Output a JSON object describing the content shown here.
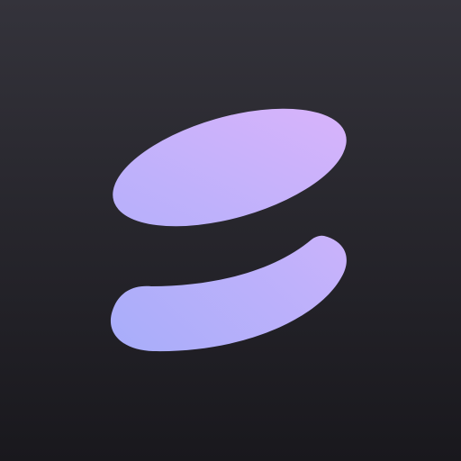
{
  "app_icon": {
    "name": "logo-mark",
    "shapes": [
      "upper-ellipse",
      "lower-crescent"
    ],
    "colors": {
      "background_top": "#34333b",
      "background_bottom": "#19181d",
      "gradient_start": "#dcb4fb",
      "gradient_mid": "#bfb1fb",
      "gradient_end": "#a8adfa"
    }
  }
}
